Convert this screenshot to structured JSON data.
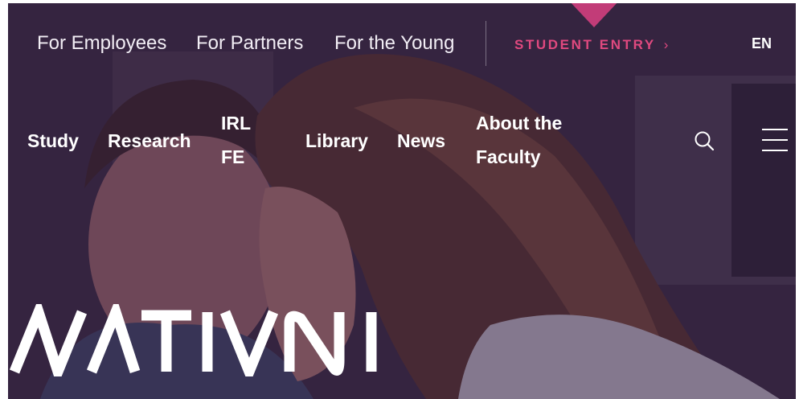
{
  "top_nav": {
    "for_employees": "For Employees",
    "for_partners": "For Partners",
    "for_the_young": "For the Young",
    "student_entry": "STUDENT ENTRY",
    "student_entry_chevron": "›",
    "language": "EN"
  },
  "main_nav": {
    "study": "Study",
    "research": "Research",
    "irl_fe_line1": "IRL",
    "irl_fe_line2": "FE",
    "library": "Library",
    "news": "News",
    "about_line1": "About the",
    "about_line2": "Faculty"
  },
  "icons": {
    "search": "search-icon",
    "menu": "hamburger-menu-icon",
    "logo": "mativni-logo"
  },
  "colors": {
    "accent_pink": "#e0497f",
    "marker_pink": "#c23c78",
    "overlay_purple": "#301c42",
    "text_white": "#ffffff"
  },
  "logo": {
    "wordmark": "MATIVNI"
  }
}
